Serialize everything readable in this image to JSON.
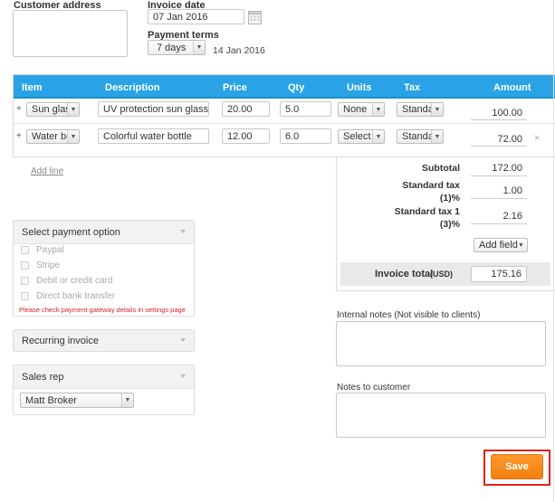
{
  "customer": {
    "label": "Customer address",
    "value": ""
  },
  "invoice_date": {
    "label": "Invoice date",
    "value": "07 Jan 2016"
  },
  "payment_terms": {
    "label": "Payment terms",
    "value": "7 days",
    "due_date": "14 Jan 2016"
  },
  "table": {
    "headers": {
      "item": "Item",
      "description": "Description",
      "price": "Price",
      "qty": "Qty",
      "units": "Units",
      "tax": "Tax",
      "amount": "Amount"
    },
    "rows": [
      {
        "item": "Sun glass",
        "description": "UV protection sun glasses",
        "price": "20.00",
        "qty": "5.0",
        "units": "None",
        "tax": "Standa",
        "amount": "100.00"
      },
      {
        "item": "Water bot",
        "description": "Colorful water bottle",
        "price": "12.00",
        "qty": "6.0",
        "units": "Select",
        "tax": "Standa",
        "amount": "72.00"
      }
    ],
    "plus": "+",
    "remove": "×",
    "add_line": "Add line"
  },
  "totals": {
    "subtotal_label": "Subtotal",
    "subtotal": "172.00",
    "tax1_label_a": "Standard tax",
    "tax1_label_b": "(1)%",
    "tax1": "1.00",
    "tax2_label_a": "Standard tax 1",
    "tax2_label_b": "(3)%",
    "tax2": "2.16",
    "add_field": "Add field",
    "invoice_total_label": "Invoice total",
    "currency": "(USD)",
    "invoice_total": "175.16"
  },
  "payment": {
    "title": "Select payment option",
    "options": [
      "Paypal",
      "Stripe",
      "Debit or credit card",
      "Direct bank transfer"
    ],
    "warning": "Please check payment gateway details in settings page"
  },
  "recurring": {
    "title": "Recurring invoice"
  },
  "sales_rep": {
    "title": "Sales rep",
    "value": "Matt Broker"
  },
  "internal_notes": {
    "label": "Internal notes (Not visible to clients)"
  },
  "customer_notes": {
    "label": "Notes to customer"
  },
  "save": {
    "label": "Save"
  },
  "colors": {
    "header_blue": "#29a3e6",
    "save_orange": "#f58a1f",
    "highlight_red": "#e0201c",
    "warning_red": "#e02020"
  },
  "icons": {
    "calendar": "calendar-icon",
    "caret": "chevron-down-icon",
    "add": "plus-icon",
    "remove": "close-icon"
  }
}
